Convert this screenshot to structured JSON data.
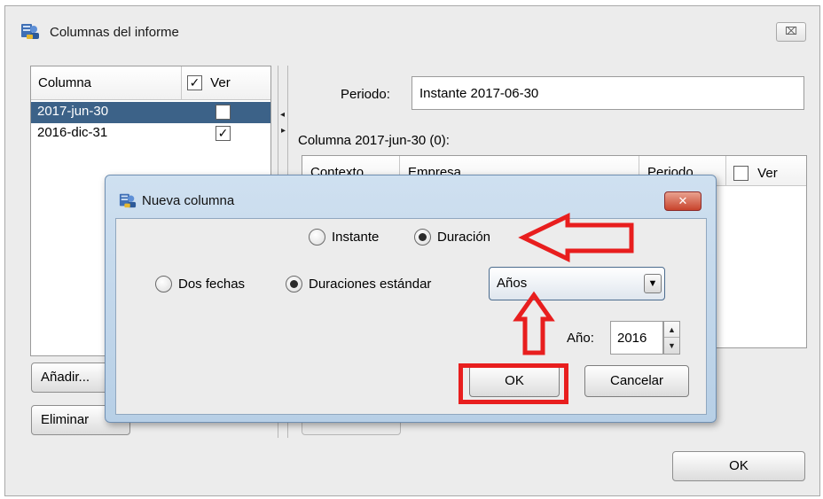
{
  "main_window": {
    "title": "Columnas del informe",
    "close_glyph": "⌧",
    "icon": "report-columns-icon"
  },
  "columns_table": {
    "headers": {
      "columna": "Columna",
      "ver": "Ver",
      "ver_checked": "✓"
    },
    "rows": [
      {
        "name": "2017-jun-30",
        "ver": "✓",
        "selected": true
      },
      {
        "name": "2016-dic-31",
        "ver": "✓",
        "selected": false
      }
    ]
  },
  "buttons": {
    "add": "Añadir...",
    "delete": "Eliminar",
    "ok": "OK"
  },
  "splitter": {
    "left_arrow": "◂",
    "right_arrow": "▸"
  },
  "period": {
    "label": "Periodo:",
    "value": "Instante 2017-06-30"
  },
  "column_caption": "Columna 2017-jun-30 (0):",
  "detail_table": {
    "headers": [
      "Contexto",
      "Empresa",
      "Periodo",
      "Ver"
    ]
  },
  "dialog": {
    "title": "Nueva columna",
    "close_glyph": "✕",
    "period_type": {
      "instante": "Instante",
      "duracion": "Duración",
      "selected": "duracion"
    },
    "range_type": {
      "dos_fechas": "Dos fechas",
      "duraciones": "Duraciones estándar",
      "selected": "duraciones"
    },
    "durations_select": {
      "value": "Años",
      "arrow": "▼"
    },
    "year": {
      "label": "Año:",
      "value": "2016",
      "up": "▲",
      "down": "▼"
    },
    "ok": "OK",
    "cancel": "Cancelar"
  },
  "annotations": {
    "color": "#e81e1e",
    "items": [
      "arrow-to-duracion",
      "arrow-to-durations-select",
      "box-around-ok"
    ]
  }
}
